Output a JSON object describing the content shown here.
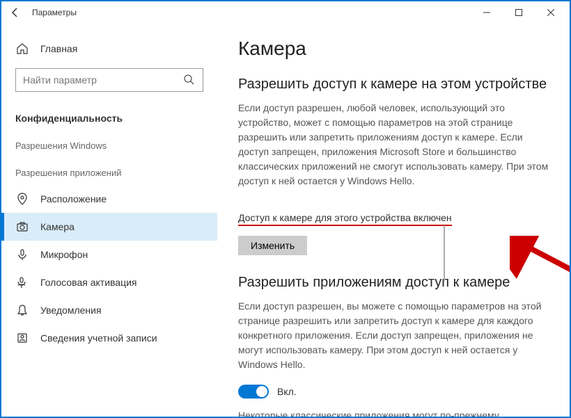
{
  "titlebar": {
    "title": "Параметры"
  },
  "sidebar": {
    "home": "Главная",
    "search_placeholder": "Найти параметр",
    "privacy": "Конфиденциальность",
    "windows_perms": "Разрешения Windows",
    "app_perms": "Разрешения приложений",
    "items": {
      "location": "Расположение",
      "camera": "Камера",
      "microphone": "Микрофон",
      "voice": "Голосовая активация",
      "notifications": "Уведомления",
      "account": "Сведения учетной записи"
    }
  },
  "main": {
    "h1": "Камера",
    "section1_h2": "Разрешить доступ к камере на этом устройстве",
    "section1_body": "Если доступ разрешен, любой человек, использующий это устройство, может с помощью параметров на этой странице разрешить или запретить приложениям доступ к камере. Если доступ запрещен, приложения Microsoft Store и большинство классических приложений не смогут использовать камеру. При этом доступ к ней остается у Windows Hello.",
    "device_status": "Доступ к камере для этого устройства включен",
    "change_btn": "Изменить",
    "section2_h2": "Разрешить приложениям доступ к камере",
    "section2_body": "Если доступ разрешен, вы можете с помощью параметров на этой странице разрешить или запретить доступ к камере для каждого конкретного приложения. Если доступ запрещен, приложения не могут использовать камеру. При этом доступ к ней остается у Windows Hello.",
    "toggle_on": "Вкл.",
    "footer_note": "Некоторые классические приложения могут по-прежнему"
  }
}
